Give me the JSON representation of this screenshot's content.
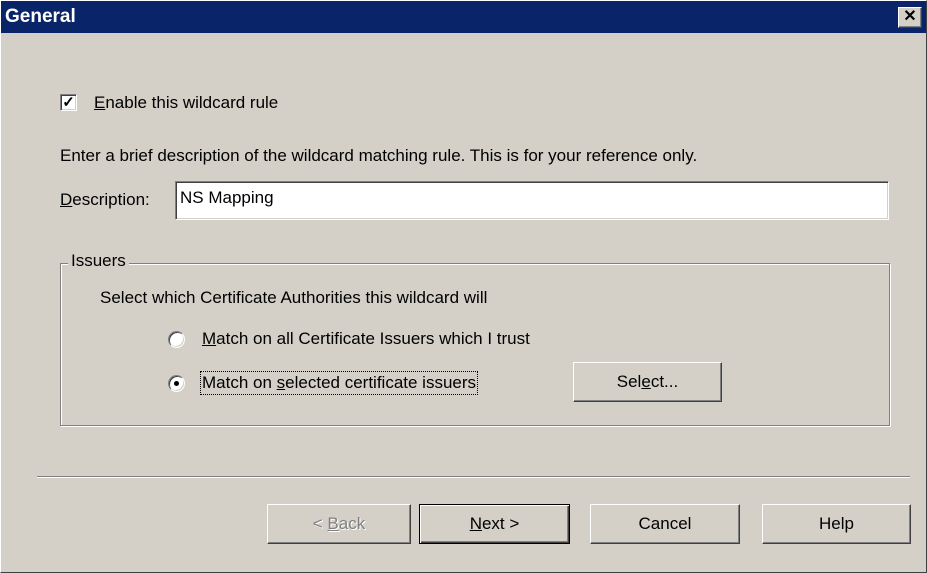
{
  "window": {
    "title": "General",
    "close_glyph": "✕"
  },
  "enable_rule": {
    "label": "Enable this wildcard rule",
    "underline_char": "E",
    "label_rest": "nable this wildcard rule",
    "checked": true,
    "check_glyph": "✓"
  },
  "instruction": "Enter a brief description of the wildcard matching rule. This is for your reference only.",
  "description": {
    "label_u": "D",
    "label_rest": "escription:",
    "value": "NS Mapping"
  },
  "issuers": {
    "legend": "Issuers",
    "prompt": "Select which Certificate Authorities this wildcard will",
    "options": [
      {
        "label_u": "M",
        "label_rest": "atch on all Certificate Issuers which I trust",
        "selected": false
      },
      {
        "label_pre": "Match on ",
        "label_u": "s",
        "label_rest": "elected certificate issuers",
        "selected": true
      }
    ],
    "select_button": {
      "pre": "Sel",
      "u": "e",
      "rest": "ct..."
    }
  },
  "buttons": {
    "back": {
      "pre": "< ",
      "u": "B",
      "rest": "ack",
      "enabled": false
    },
    "next": {
      "u": "N",
      "rest": "ext >"
    },
    "cancel": "Cancel",
    "help": "Help"
  }
}
